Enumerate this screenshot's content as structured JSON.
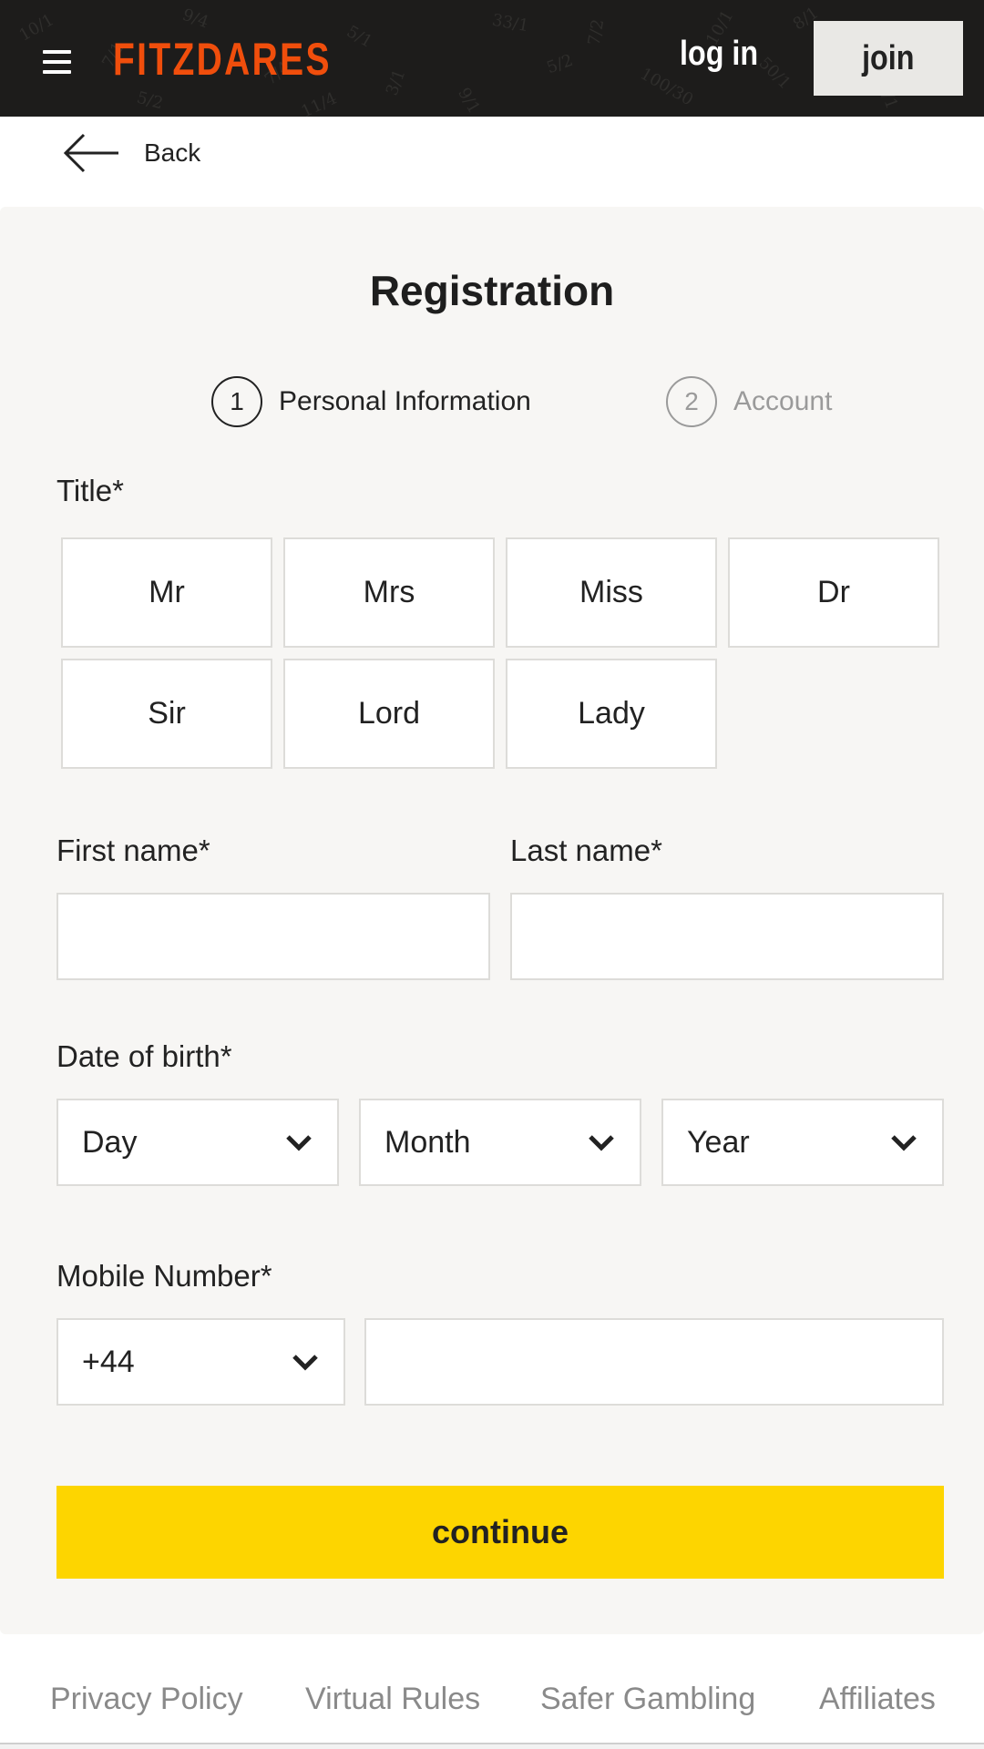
{
  "header": {
    "brand": "FITZDARES",
    "menu_icon": "hamburger-menu-icon",
    "login_label": "log in",
    "join_label": "join",
    "brand_color": "#f04e0c",
    "background_odds": [
      "10/1",
      "7/1",
      "9/4",
      "7/4",
      "5/1",
      "3/1",
      "33/1",
      "5/2",
      "7/2",
      "100/30",
      "10/1",
      "50/1",
      "8/1",
      "2/1",
      "7/4",
      "5/2",
      "11/4",
      "9/1"
    ]
  },
  "nav": {
    "back_icon": "arrow-left-icon",
    "back_label": "Back"
  },
  "form": {
    "title": "Registration",
    "steps": [
      {
        "number": "1",
        "label": "Personal Information",
        "state": "active"
      },
      {
        "number": "2",
        "label": "Account",
        "state": "inactive"
      }
    ],
    "title_field": {
      "label": "Title*",
      "options": [
        "Mr",
        "Mrs",
        "Miss",
        "Dr",
        "Sir",
        "Lord",
        "Lady"
      ]
    },
    "first_name": {
      "label": "First name*",
      "value": ""
    },
    "last_name": {
      "label": "Last name*",
      "value": ""
    },
    "dob": {
      "label": "Date of birth*",
      "day": "Day",
      "month": "Month",
      "year": "Year"
    },
    "mobile": {
      "label": "Mobile Number*",
      "country_code": "+44",
      "value": ""
    },
    "continue_label": "continue",
    "accent_color": "#fdd500"
  },
  "footer": {
    "links": [
      "Privacy Policy",
      "Virtual Rules",
      "Safer Gambling",
      "Affiliates"
    ]
  }
}
